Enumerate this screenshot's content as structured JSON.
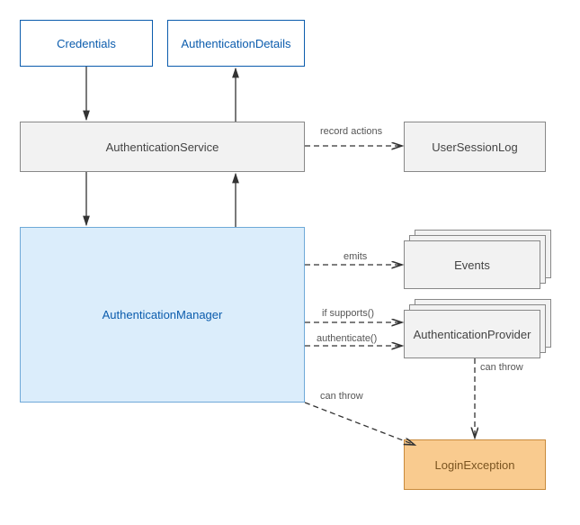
{
  "nodes": {
    "credentials": "Credentials",
    "authDetails": "AuthenticationDetails",
    "authService": "AuthenticationService",
    "userSessionLog": "UserSessionLog",
    "authManager": "AuthenticationManager",
    "events": "Events",
    "authProvider": "AuthenticationProvider",
    "loginException": "LoginException"
  },
  "edges": {
    "recordActions": "record actions",
    "emits": "emits",
    "ifSupports": "if supports()",
    "authenticate": "authenticate()",
    "canThrow1": "can throw",
    "canThrow2": "can throw"
  }
}
